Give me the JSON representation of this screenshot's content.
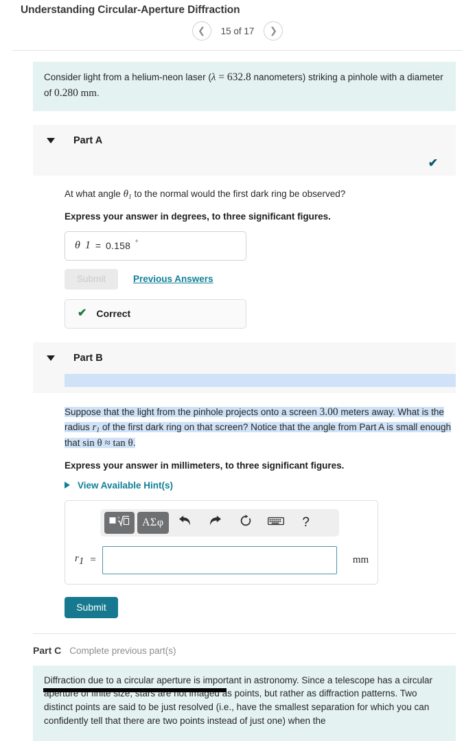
{
  "header": {
    "title": "Understanding Circular-Aperture Diffraction",
    "prev_icon": "chevron-left-icon",
    "next_icon": "chevron-right-icon",
    "pager_label": "15 of 17"
  },
  "intro": {
    "text_1": "Consider light from a helium-neon laser (",
    "lambda": "λ",
    "eq": "=",
    "value": "632.8",
    "text_2": " nanometers) striking a pinhole with a diameter of ",
    "diameter": "0.280",
    "unit": "mm",
    "period": "."
  },
  "part_a": {
    "name": "Part A",
    "caret": "caret-down-icon",
    "status_icon": "check-icon",
    "question_pre": "At what angle ",
    "question_var": "θ",
    "question_var_sub": "1",
    "question_post": " to the normal would the first dark ring be observed?",
    "instruction": "Express your answer in degrees, to three significant figures.",
    "answer_var": "θ",
    "answer_var_sub": "1",
    "answer_eq": "=",
    "answer_value": "0.158",
    "answer_unit": "°",
    "submit_label": "Submit",
    "previous_answers_label": "Previous Answers",
    "feedback_icon": "check-icon",
    "feedback_label": "Correct"
  },
  "part_b": {
    "name": "Part B",
    "caret": "caret-down-icon",
    "q_1": "Suppose that the light from the pinhole projects onto a screen ",
    "q_distance": "3.00",
    "q_2": " meters away. What is the radius ",
    "q_var": "r",
    "q_var_sub": "1",
    "q_3": " of the first dark ring on that screen? Notice that the angle from Part A is small enough that ",
    "q_math": "sin θ ≈ tan θ",
    "q_4": ".",
    "instruction": "Express your answer in millimeters, to three significant figures.",
    "hint_icon": "triangle-right-icon",
    "hint_label": "View Available Hint(s)",
    "toolbar": {
      "template_icon": "math-template-icon",
      "greek_label": "ΑΣφ",
      "undo_icon": "undo-icon",
      "redo_icon": "redo-icon",
      "reset_icon": "reset-icon",
      "keyboard_icon": "keyboard-icon",
      "help_label": "?"
    },
    "input_var": "r",
    "input_var_sub": "1",
    "input_eq": "=",
    "input_value": "",
    "input_unit": "mm",
    "submit_label": "Submit"
  },
  "part_c": {
    "name": "Part C",
    "note": "Complete previous part(s)",
    "info_text": "Diffraction due to a circular aperture is important in astronomy. Since a telescope has a circular aperture of finite size, stars are not imaged as points, but rather as diffraction patterns. Two distinct points are said to be just resolved (i.e., have the smallest separation for which you can confidently tell that there are two points instead of just one) when the"
  },
  "colors": {
    "accent_teal": "#17798f",
    "link_teal": "#0f7f97",
    "info_bg": "#e4f2f1",
    "selection_blue": "#cfe2f7",
    "correct_green": "#1a7a35",
    "toolbar_dark": "#6e7072"
  }
}
